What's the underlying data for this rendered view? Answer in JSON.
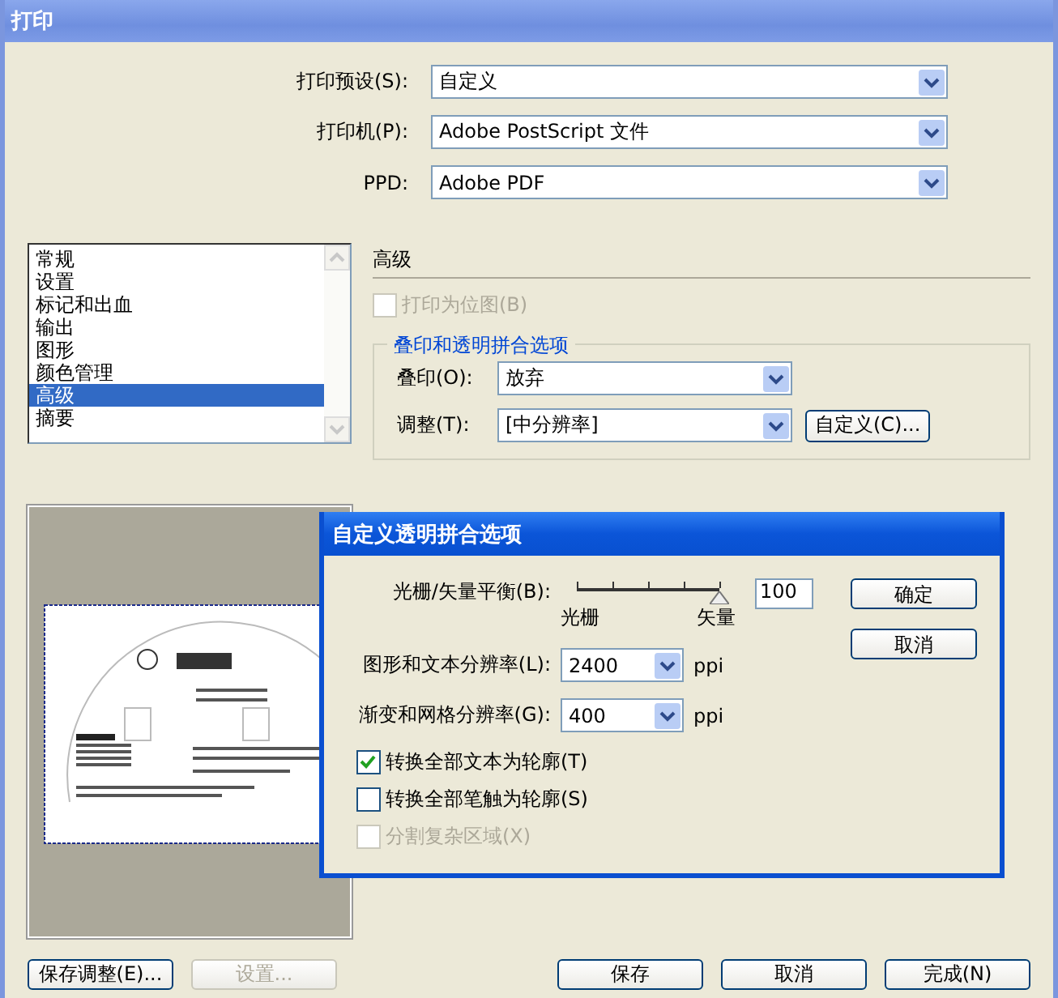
{
  "window": {
    "title": "打印"
  },
  "top_fields": [
    {
      "label": "打印预设(S):",
      "value": "自定义"
    },
    {
      "label": "打印机(P):",
      "value": "Adobe PostScript 文件"
    },
    {
      "label": "PPD:",
      "value": "Adobe PDF"
    }
  ],
  "categories": [
    {
      "label": "常规",
      "selected": false
    },
    {
      "label": "设置",
      "selected": false
    },
    {
      "label": "标记和出血",
      "selected": false
    },
    {
      "label": "输出",
      "selected": false
    },
    {
      "label": "图形",
      "selected": false
    },
    {
      "label": "颜色管理",
      "selected": false
    },
    {
      "label": "高级",
      "selected": true
    },
    {
      "label": "摘要",
      "selected": false
    }
  ],
  "section": {
    "title": "高级",
    "print_as_bitmap": {
      "label": "打印为位图(B)",
      "checked": false,
      "disabled": true
    },
    "group": {
      "title": "叠印和透明拼合选项",
      "fields": [
        {
          "label": "叠印(O):",
          "value": "放弃"
        },
        {
          "label": "调整(T):",
          "value": "[中分辨率]",
          "button": "自定义(C)..."
        }
      ]
    }
  },
  "buttons_left": [
    {
      "label": "保存调整(E)...",
      "disabled": false
    },
    {
      "label": "设置...",
      "disabled": true
    }
  ],
  "buttons_right": [
    {
      "label": "保存",
      "disabled": false
    },
    {
      "label": "取消",
      "disabled": false
    },
    {
      "label": "完成(N)",
      "disabled": false
    }
  ],
  "popup": {
    "title": "自定义透明拼合选项",
    "slider": {
      "label": "光栅/矢量平衡(B):",
      "level": 1,
      "min_label": "光栅",
      "max_label": "矢量",
      "value": "100"
    },
    "resolutions": [
      {
        "label": "图形和文本分辨率(L):",
        "value": "2400",
        "unit": "ppi"
      },
      {
        "label": "渐变和网格分辨率(G):",
        "value": "400",
        "unit": "ppi"
      }
    ],
    "options": [
      {
        "label": "转换全部文本为轮廓(T)",
        "checked": true,
        "disabled": false
      },
      {
        "label": "转换全部笔触为轮廓(S)",
        "checked": false,
        "disabled": false
      },
      {
        "label": "分割复杂区域(X)",
        "checked": false,
        "disabled": true
      }
    ],
    "buttons": [
      "确定",
      "取消"
    ]
  }
}
